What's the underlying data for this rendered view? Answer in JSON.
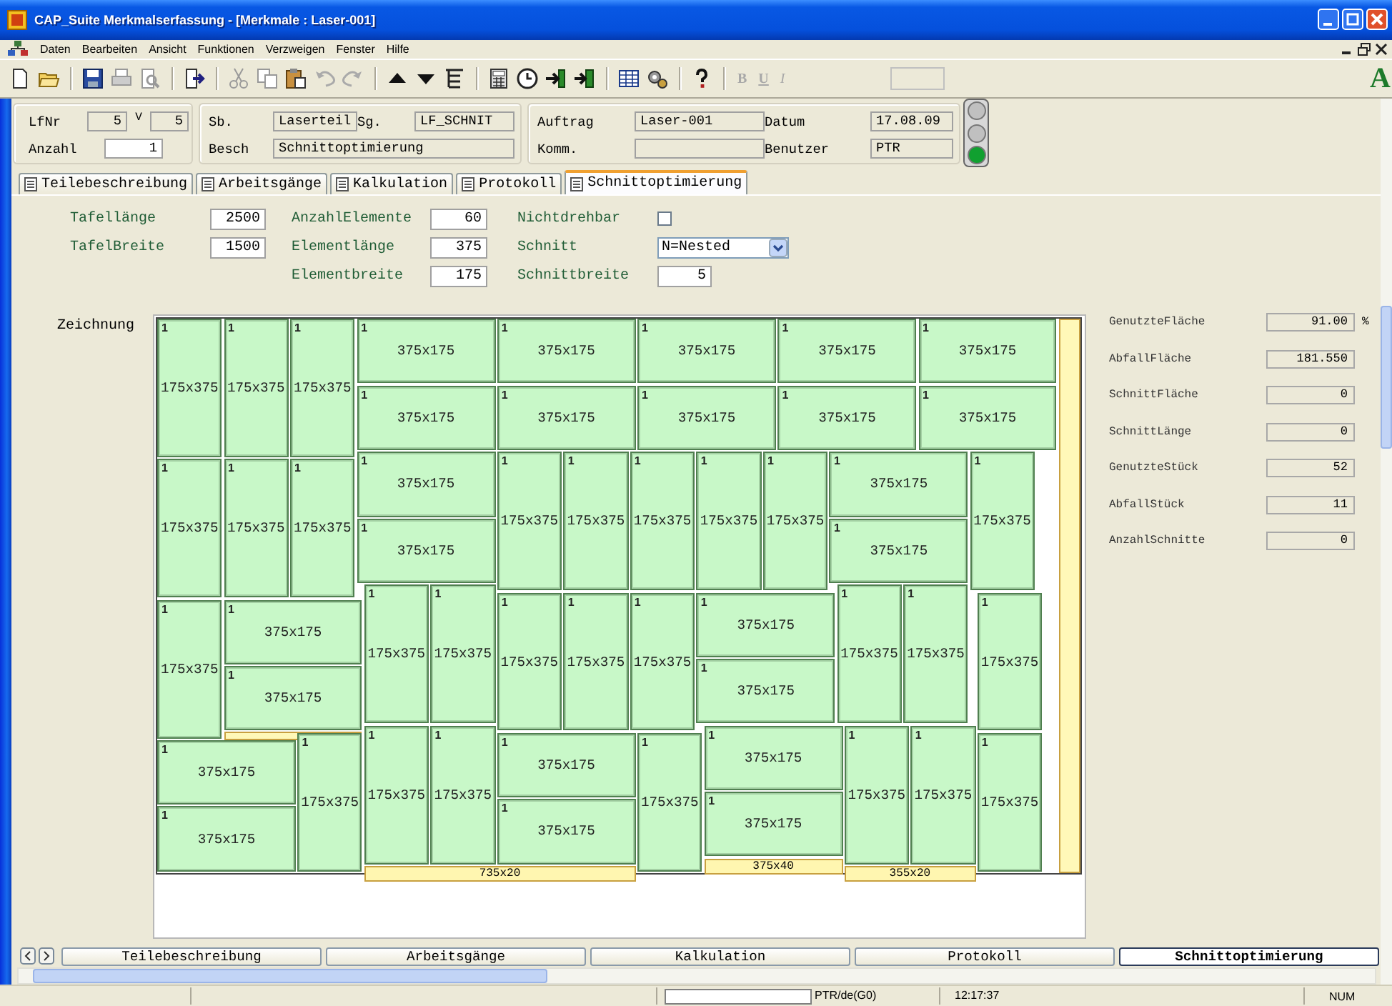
{
  "window": {
    "title": "CAP_Suite Merkmalserfassung - [Merkmale : Laser-001]"
  },
  "menu": [
    "Daten",
    "Bearbeiten",
    "Ansicht",
    "Funktionen",
    "Verzweigen",
    "Fenster",
    "Hilfe"
  ],
  "toolbar": {
    "format_buttons": [
      {
        "label": "B",
        "disabled": true
      },
      {
        "label": "U",
        "disabled": true
      },
      {
        "label": "I",
        "disabled": true
      }
    ],
    "logo": "A"
  },
  "header": {
    "lfnr": {
      "label": "LfNr",
      "value": "5",
      "editable": false
    },
    "version": {
      "label": "V",
      "value": "5",
      "editable": false
    },
    "anzahl": {
      "label": "Anzahl",
      "value": "1",
      "editable": true
    },
    "sb": {
      "label": "Sb.",
      "value": "Laserteil",
      "editable": false
    },
    "sg": {
      "label": "Sg.",
      "value": "LF_SCHNIT",
      "editable": false
    },
    "besch": {
      "label": "Besch",
      "value": "Schnittoptimierung",
      "editable": false
    },
    "auftrag": {
      "label": "Auftrag",
      "value": "Laser-001",
      "editable": false
    },
    "komm": {
      "label": "Komm.",
      "editable": false
    },
    "datum": {
      "label": "Datum",
      "value": "17.08.09",
      "editable": false
    },
    "benutzer": {
      "label": "Benutzer",
      "value": "PTR",
      "editable": false
    },
    "signal_lamps": [
      {
        "on": false
      },
      {
        "on": false
      },
      {
        "on": true
      }
    ]
  },
  "tabs": [
    {
      "label": "Teilebeschreibung",
      "selected": false
    },
    {
      "label": "Arbeitsgänge",
      "selected": false
    },
    {
      "label": "Kalkulation",
      "selected": false
    },
    {
      "label": "Protokoll",
      "selected": false
    },
    {
      "label": "Schnittoptimierung",
      "selected": true
    }
  ],
  "form": {
    "columns": [
      [
        {
          "kind": "number",
          "label": "Tafellänge",
          "value": "2500"
        },
        {
          "kind": "number",
          "label": "TafelBreite",
          "value": "1500"
        }
      ],
      [
        {
          "kind": "number",
          "label": "AnzahlElemente",
          "value": "60"
        },
        {
          "kind": "number",
          "label": "Elementlänge",
          "value": "375"
        },
        {
          "kind": "number",
          "label": "Elementbreite",
          "value": "175"
        }
      ],
      [
        {
          "kind": "checkbox",
          "label": "Nichtdrehbar",
          "checked": false
        },
        {
          "kind": "select",
          "label": "Schnitt",
          "value": "N=Nested"
        },
        {
          "kind": "number",
          "label": "Schnittbreite",
          "value": "5"
        }
      ]
    ]
  },
  "drawing": {
    "label": "Zeichnung",
    "pieces": [
      {
        "qty": "1",
        "size": "175x375"
      },
      {
        "qty": "1",
        "size": "175x375"
      },
      {
        "qty": "1",
        "size": "175x375"
      },
      {
        "qty": "1",
        "size": "375x175"
      },
      {
        "qty": "1",
        "size": "375x175"
      },
      {
        "qty": "1",
        "size": "375x175"
      },
      {
        "qty": "1",
        "size": "375x175"
      },
      {
        "qty": "1",
        "size": "375x175"
      },
      {
        "qty": "1",
        "size": "375x175"
      },
      {
        "qty": "1",
        "size": "375x175"
      },
      {
        "qty": "1",
        "size": "375x175"
      },
      {
        "qty": "1",
        "size": "375x175"
      },
      {
        "qty": "1",
        "size": "375x175"
      },
      {
        "qty": "1",
        "size": "175x375"
      },
      {
        "qty": "1",
        "size": "175x375"
      },
      {
        "qty": "1",
        "size": "175x375"
      },
      {
        "qty": "1",
        "size": "375x175"
      },
      {
        "qty": "1",
        "size": "375x175"
      },
      {
        "qty": "1",
        "size": "175x375"
      },
      {
        "qty": "1",
        "size": "175x375"
      },
      {
        "qty": "1",
        "size": "175x375"
      },
      {
        "qty": "1",
        "size": "175x375"
      },
      {
        "qty": "1",
        "size": "175x375"
      },
      {
        "qty": "1",
        "size": "375x175"
      },
      {
        "qty": "1",
        "size": "375x175"
      },
      {
        "qty": "1",
        "size": "175x375"
      },
      {
        "qty": "1",
        "size": "175x375"
      },
      {
        "qty": "1",
        "size": "375x175"
      },
      {
        "qty": "1",
        "size": "375x175"
      },
      {
        "qty": "1",
        "size": "175x375"
      },
      {
        "qty": "1",
        "size": "175x375"
      },
      {
        "qty": "1",
        "size": "175x375"
      },
      {
        "qty": "1",
        "size": "175x375"
      },
      {
        "qty": "1",
        "size": "175x375"
      },
      {
        "qty": "1",
        "size": "375x175"
      },
      {
        "qty": "1",
        "size": "375x175"
      },
      {
        "qty": "1",
        "size": "175x375"
      },
      {
        "qty": "1",
        "size": "175x375"
      },
      {
        "qty": "1",
        "size": "175x375"
      },
      {
        "qty": "1",
        "size": "375x175"
      },
      {
        "qty": "1",
        "size": "375x175"
      },
      {
        "qty": "1",
        "size": "175x375"
      },
      {
        "qty": "1",
        "size": "175x375"
      },
      {
        "qty": "1",
        "size": "175x375"
      },
      {
        "qty": "1",
        "size": "375x175"
      },
      {
        "qty": "1",
        "size": "375x175"
      },
      {
        "qty": "1",
        "size": "175x375"
      },
      {
        "qty": "1",
        "size": "375x175"
      },
      {
        "qty": "1",
        "size": "375x175"
      },
      {
        "qty": "1",
        "size": "175x375"
      },
      {
        "qty": "1",
        "size": "175x375"
      },
      {
        "qty": "1",
        "size": "175x375"
      }
    ],
    "offcuts": [
      {
        "size": "735x20"
      },
      {
        "size": "375x40"
      },
      {
        "size": "355x20"
      }
    ]
  },
  "stats": [
    {
      "label": "GenutzteFläche",
      "value": "91.00",
      "unit": "%"
    },
    {
      "label": "AbfallFläche",
      "value": "181.550"
    },
    {
      "label": "SchnittFläche",
      "value": "0"
    },
    {
      "label": "SchnittLänge",
      "value": "0"
    },
    {
      "label": "GenutzteStück",
      "value": "52"
    },
    {
      "label": "AbfallStück",
      "value": "11"
    },
    {
      "label": "AnzahlSchnitte",
      "value": "0"
    }
  ],
  "bottom_tabs": [
    {
      "label": "Teilebeschreibung",
      "selected": false
    },
    {
      "label": "Arbeitsgänge",
      "selected": false
    },
    {
      "label": "Kalkulation",
      "selected": false
    },
    {
      "label": "Protokoll",
      "selected": false
    },
    {
      "label": "Schnittoptimierung",
      "selected": true
    }
  ],
  "status_bar": {
    "user": "PTR/de(G0)",
    "time": "12:17:37",
    "mode": "NUM"
  }
}
